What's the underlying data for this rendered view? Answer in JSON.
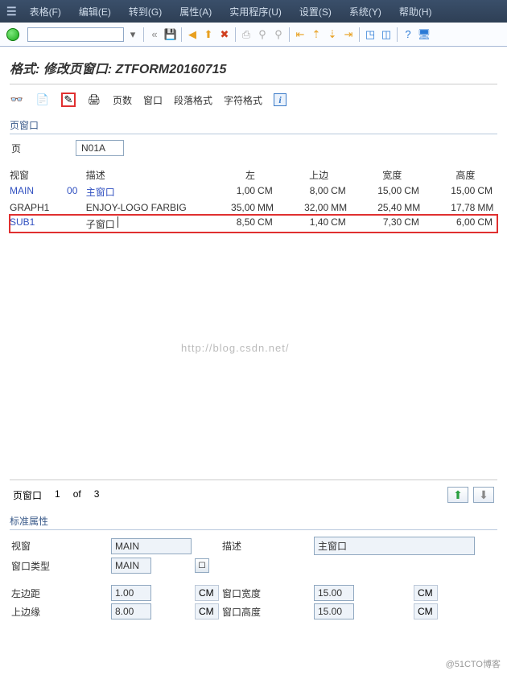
{
  "menubar": {
    "items": [
      "表格(F)",
      "编辑(E)",
      "转到(G)",
      "属性(A)",
      "实用程序(U)",
      "设置(S)",
      "系统(Y)",
      "帮助(H)"
    ]
  },
  "title": "格式: 修改页窗口: ZTFORM20160715",
  "tabs": {
    "pages": "页数",
    "window": "窗口",
    "para": "段落格式",
    "char": "字符格式"
  },
  "page_window": {
    "section": "页窗口",
    "page_label": "页",
    "page_value": "N01A",
    "headers": {
      "win": "视窗",
      "desc": "描述",
      "left": "左",
      "top": "上边",
      "width": "宽度",
      "height": "高度"
    },
    "rows": [
      {
        "name": "MAIN",
        "num": "00",
        "desc": "主窗口",
        "left": "1,00",
        "lu": "CM",
        "top": "8,00",
        "tu": "CM",
        "w": "15,00",
        "wu": "CM",
        "h": "15,00",
        "hu": "CM",
        "blue": true
      },
      {
        "name": "GRAPH1",
        "num": "",
        "desc": "ENJOY-LOGO FARBIG",
        "left": "35,00",
        "lu": "MM",
        "top": "32,00",
        "tu": "MM",
        "w": "25,40",
        "wu": "MM",
        "h": "17,78",
        "hu": "MM"
      },
      {
        "name": "SUB1",
        "num": "",
        "desc": "子窗口",
        "left": "8,50",
        "lu": "CM",
        "top": "1,40",
        "tu": "CM",
        "w": "7,30",
        "wu": "CM",
        "h": "6,00",
        "hu": "CM",
        "hl": true
      }
    ],
    "pager": {
      "label": "页窗口",
      "cur": "1",
      "of": "of",
      "total": "3"
    }
  },
  "attrs": {
    "section": "标准属性",
    "win_lbl": "视窗",
    "win_val": "MAIN",
    "type_lbl": "窗口类型",
    "type_val": "MAIN",
    "desc_lbl": "描述",
    "desc_val": "主窗口",
    "lmargin_lbl": "左边距",
    "lmargin_val": "1.00",
    "lmargin_u": "CM",
    "tmargin_lbl": "上边缘",
    "tmargin_val": "8.00",
    "tmargin_u": "CM",
    "wwidth_lbl": "窗口宽度",
    "wwidth_val": "15.00",
    "wwidth_u": "CM",
    "wheight_lbl": "窗口高度",
    "wheight_val": "15.00",
    "wheight_u": "CM"
  },
  "watermark": "http://blog.csdn.net/",
  "footer": "@51CTO博客"
}
